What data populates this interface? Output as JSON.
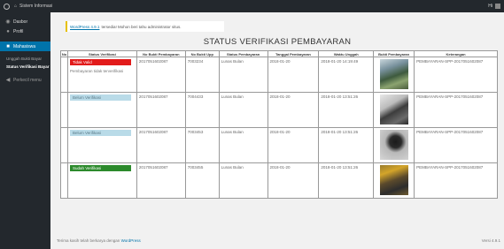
{
  "topbar": {
    "site_name": "Sistem Informasi",
    "howdy": "Hi"
  },
  "sidebar": {
    "items": [
      {
        "label": "Dasbor",
        "icon": "dashboard-icon"
      },
      {
        "label": "Profil",
        "icon": "user-icon"
      },
      {
        "label": "Mahasiswa",
        "icon": "students-icon"
      }
    ],
    "subitems": [
      {
        "label": "Unggah Bukti Bayar"
      },
      {
        "label": "Status Verifikasi Bayar"
      }
    ],
    "collapse_label": "Perkecil menu"
  },
  "notice": {
    "link": "WordPress 4.9.1",
    "text": "tersedia! Mohon beri tahu administrator situs."
  },
  "page_title": "STATUS VERIFIKASI PEMBAYARAN",
  "table": {
    "headers": [
      "No",
      "Status Verifikasi",
      "No Bukti Pembayaran",
      "No Bukti Upp",
      "Status Pembayaran",
      "Tanggal Pembayaran",
      "Waktu Unggah",
      "Bukti Pembayaran",
      "Keterangan"
    ],
    "rows": [
      {
        "no": "",
        "status": "Tidak Valid",
        "status_color": "red",
        "note": "Pembayaran tidak terverifikasi",
        "bukti": "2017051602087",
        "upp": "7003234",
        "status_bayar": "Lunas Bulan",
        "tanggal": "2018-01-20",
        "waktu": "2018-01-20 14:19:49",
        "photo": "photo-1",
        "keterangan": "PEMBAYARAN-SPP-2017051602087"
      },
      {
        "no": "",
        "status": "Belum Verifikasi",
        "status_color": "blue",
        "note": "",
        "bukti": "2017051602087",
        "upp": "7004433",
        "status_bayar": "Lunas Bulan",
        "tanggal": "2018-01-20",
        "waktu": "2018-01-20 13:51:26",
        "photo": "photo-2",
        "keterangan": "PEMBAYARAN-SPP-2017051602087"
      },
      {
        "no": "",
        "status": "Belum Verifikasi",
        "status_color": "blue",
        "note": "",
        "bukti": "2017051602087",
        "upp": "7003453",
        "status_bayar": "Lunas Bulan",
        "tanggal": "2018-01-20",
        "waktu": "2018-01-20 13:51:26",
        "photo": "photo-3",
        "keterangan": "PEMBAYARAN-SPP-2017051602087"
      },
      {
        "no": "",
        "status": "Sudah Verifikasi",
        "status_color": "green",
        "note": "",
        "bukti": "2017051602087",
        "upp": "7003455",
        "status_bayar": "Lunas Bulan",
        "tanggal": "2018-01-20",
        "waktu": "2018-01-20 13:51:26",
        "photo": "photo-4",
        "keterangan": "PEMBAYARAN-SPP-2017051602087"
      }
    ]
  },
  "footer": {
    "left_text": "Terima kasih telah berkarya dengan",
    "left_link": "WordPress",
    "version": "Versi 4.9.1"
  }
}
